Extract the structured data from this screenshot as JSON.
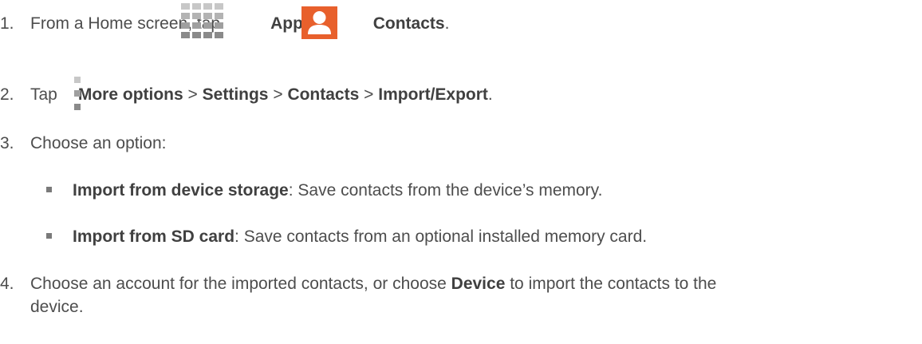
{
  "steps": [
    {
      "number": "1.",
      "text_a": "From a Home screen, tap",
      "apps_label": "Apps",
      "sep": ">",
      "contacts_label": "Contacts",
      "end": "."
    },
    {
      "number": "2.",
      "text_a": "Tap",
      "more_label": "More options",
      "sep1": ">",
      "settings_label": "Settings",
      "sep2": ">",
      "contacts_label": "Contacts",
      "sep3": ">",
      "import_label": "Import/Export",
      "end": "."
    },
    {
      "number": "3.",
      "text": "Choose an option:"
    },
    {
      "number": "4.",
      "text_a": "Choose an account for the imported contacts, or choose",
      "device_label": "Device",
      "text_b": "to import the contacts to the",
      "text_c": "device."
    }
  ],
  "options": [
    {
      "label": "Import from device storage",
      "desc": ": Save contacts from the device’s memory."
    },
    {
      "label": "Import from SD card",
      "desc": ": Save contacts from an optional installed memory card."
    }
  ],
  "icons": {
    "apps": "apps-grid-icon",
    "contacts": "contacts-icon",
    "more": "more-options-icon"
  },
  "colors": {
    "text": "#4d4d4d",
    "contacts_icon": "#e8602c"
  }
}
